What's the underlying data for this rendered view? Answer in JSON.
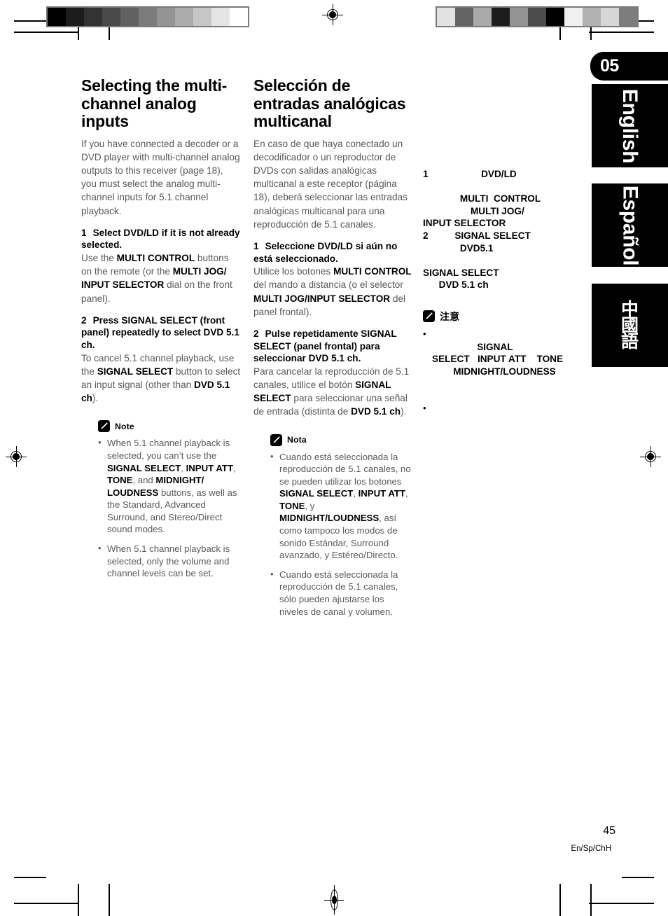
{
  "chapter_badge": "05",
  "language_tabs": [
    {
      "id": "english",
      "label": "English"
    },
    {
      "id": "espanol",
      "label": "Español"
    },
    {
      "id": "chinese",
      "label": "中國語"
    }
  ],
  "footer": {
    "page_number": "45",
    "page_code": "En/Sp/ChH"
  },
  "english": {
    "heading": "Selecting the multi-channel analog inputs",
    "intro": "If you have connected a decoder or a DVD player with multi-channel analog outputs to this receiver (page 18), you must select the analog multi-channel inputs for 5.1 channel playback.",
    "step1": {
      "num": "1",
      "title": "Select DVD/LD if it is not already selected.",
      "body_1": "Use the ",
      "body_b1": "MULTI CONTROL",
      "body_2": " buttons on the remote (or the ",
      "body_b2": "MULTI JOG/ INPUT SELECTOR",
      "body_3": " dial on the front panel)."
    },
    "step2": {
      "num": "2",
      "title": "Press SIGNAL SELECT (front panel) repeatedly to select DVD 5.1 ch.",
      "body_1": "To cancel 5.1 channel playback, use the ",
      "body_b1": "SIGNAL SELECT",
      "body_2": " button to select an input signal (other than ",
      "body_b3": "DVD 5.1 ch",
      "body_3": ")."
    },
    "note_title": "Note",
    "notes": [
      {
        "t1": "When 5.1 channel playback is selected, you can’t use the ",
        "b1": "SIGNAL SELECT",
        "t2": ", ",
        "b2": "INPUT ATT",
        "t3": ", ",
        "b3": "TONE",
        "t4": ", and ",
        "b4": "MIDNIGHT/ LOUDNESS",
        "t5": " buttons, as well as the Standard, Advanced Surround, and Stereo/Direct sound modes."
      },
      {
        "t1": "When 5.1 channel playback is selected, only the volume and channel levels can be set."
      }
    ]
  },
  "espanol": {
    "heading": "Selección de entradas analógicas multicanal",
    "intro": "En caso de que haya conectado un decodificador o un reproductor de DVDs con salidas analógicas multicanal a este receptor (página 18), deberá seleccionar las entradas analógicas multicanal para una reproducción de 5.1 canales.",
    "step1": {
      "num": "1",
      "title": "Seleccione DVD/LD si aún no está seleccionado.",
      "body_1": "Utilice los botones ",
      "body_b1": "MULTI CONTROL",
      "body_2": " del mando a distancia (o el selector ",
      "body_b2": "MULTI JOG/INPUT SELECTOR",
      "body_3": " del panel frontal)."
    },
    "step2": {
      "num": "2",
      "title": "Pulse repetidamente SIGNAL SELECT (panel frontal) para seleccionar DVD 5.1 ch.",
      "body_1": "Para cancelar la reproducción de 5.1 canales, utilice el botón ",
      "body_b1": "SIGNAL SELECT",
      "body_2": " para seleccionar una señal de entrada (distinta de ",
      "body_b3": "DVD 5.1 ch",
      "body_3": ")."
    },
    "note_title": "Nota",
    "notes": [
      {
        "t1": "Cuando está seleccionada la reproducción de 5.1 canales, no se pueden utilizar los botones ",
        "b1": "SIGNAL SELECT",
        "t2": ", ",
        "b2": "INPUT ATT",
        "t3": ", ",
        "b3": "TONE",
        "t4": ", y ",
        "b4": "MIDNIGHT/LOUDNESS",
        "t5": ", así como tampoco los modos de sonido Estándar, Surround avanzado, y Estéreo/Directo."
      },
      {
        "t1": "Cuando está seleccionada la reproducción de 5.1 canales, sólo pueden ajustarse los niveles de canal y volumen."
      }
    ]
  },
  "chinese": {
    "lines": [
      "1                    DVD/LD",
      "",
      "              MULTI  CONTROL",
      "                  MULTI JOG/",
      "INPUT SELECTOR",
      "2          SIGNAL SELECT",
      "              DVD5.1",
      "",
      "SIGNAL SELECT",
      "      DVD 5.1 ch"
    ],
    "note_title": "注意",
    "notes": [
      {
        "l1": "",
        "l2": "                 SIGNAL",
        "l3": "SELECT   INPUT ATT    TONE",
        "l4": "        MIDNIGHT/LOUDNESS"
      },
      {
        "l1": ""
      }
    ]
  },
  "print_marks": {
    "wedge_left_grays": [
      "#000000",
      "#1c1c1c",
      "#333333",
      "#4a4a4a",
      "#616161",
      "#7b7b7b",
      "#949494",
      "#ababab",
      "#c6c6c6",
      "#e4e4e4",
      "#ffffff"
    ],
    "wedge_right_grays": [
      "#e2e2e2",
      "#636363",
      "#aaaaaa",
      "#1d1d1d",
      "#949494",
      "#4c4c4c",
      "#000000",
      "#f0f0f0",
      "#b1b1b1",
      "#d6d6d6",
      "#7d7d7d"
    ]
  }
}
